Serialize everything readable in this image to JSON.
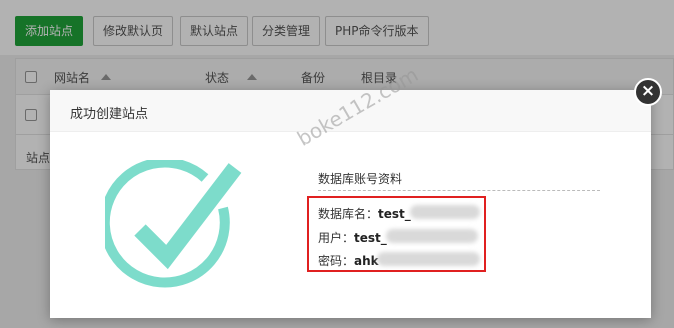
{
  "toolbar": {
    "add_site": "添加站点",
    "edit_default_page": "修改默认页",
    "default_site": "默认站点",
    "category_manage": "分类管理",
    "php_cli_version": "PHP命令行版本"
  },
  "table": {
    "columns": {
      "site_name": "网站名",
      "status": "状态",
      "backup": "备份",
      "root_dir": "根目录"
    },
    "footer_partial": "站点"
  },
  "modal": {
    "title": "成功创建站点",
    "info_title": "数据库账号资料",
    "db_name_label": "数据库名：",
    "db_name_value": "test_",
    "user_label": "用户：",
    "user_value": "test_",
    "password_label": "密码：",
    "password_value": "ahk",
    "close_glyph": "×"
  },
  "watermark": "boke112.com",
  "colors": {
    "primary_green": "#20a53a",
    "check_teal": "#7ddccb",
    "highlight_red": "#e02020"
  },
  "icons": {
    "success": "checkmark-circle-icon",
    "close": "close-icon"
  }
}
